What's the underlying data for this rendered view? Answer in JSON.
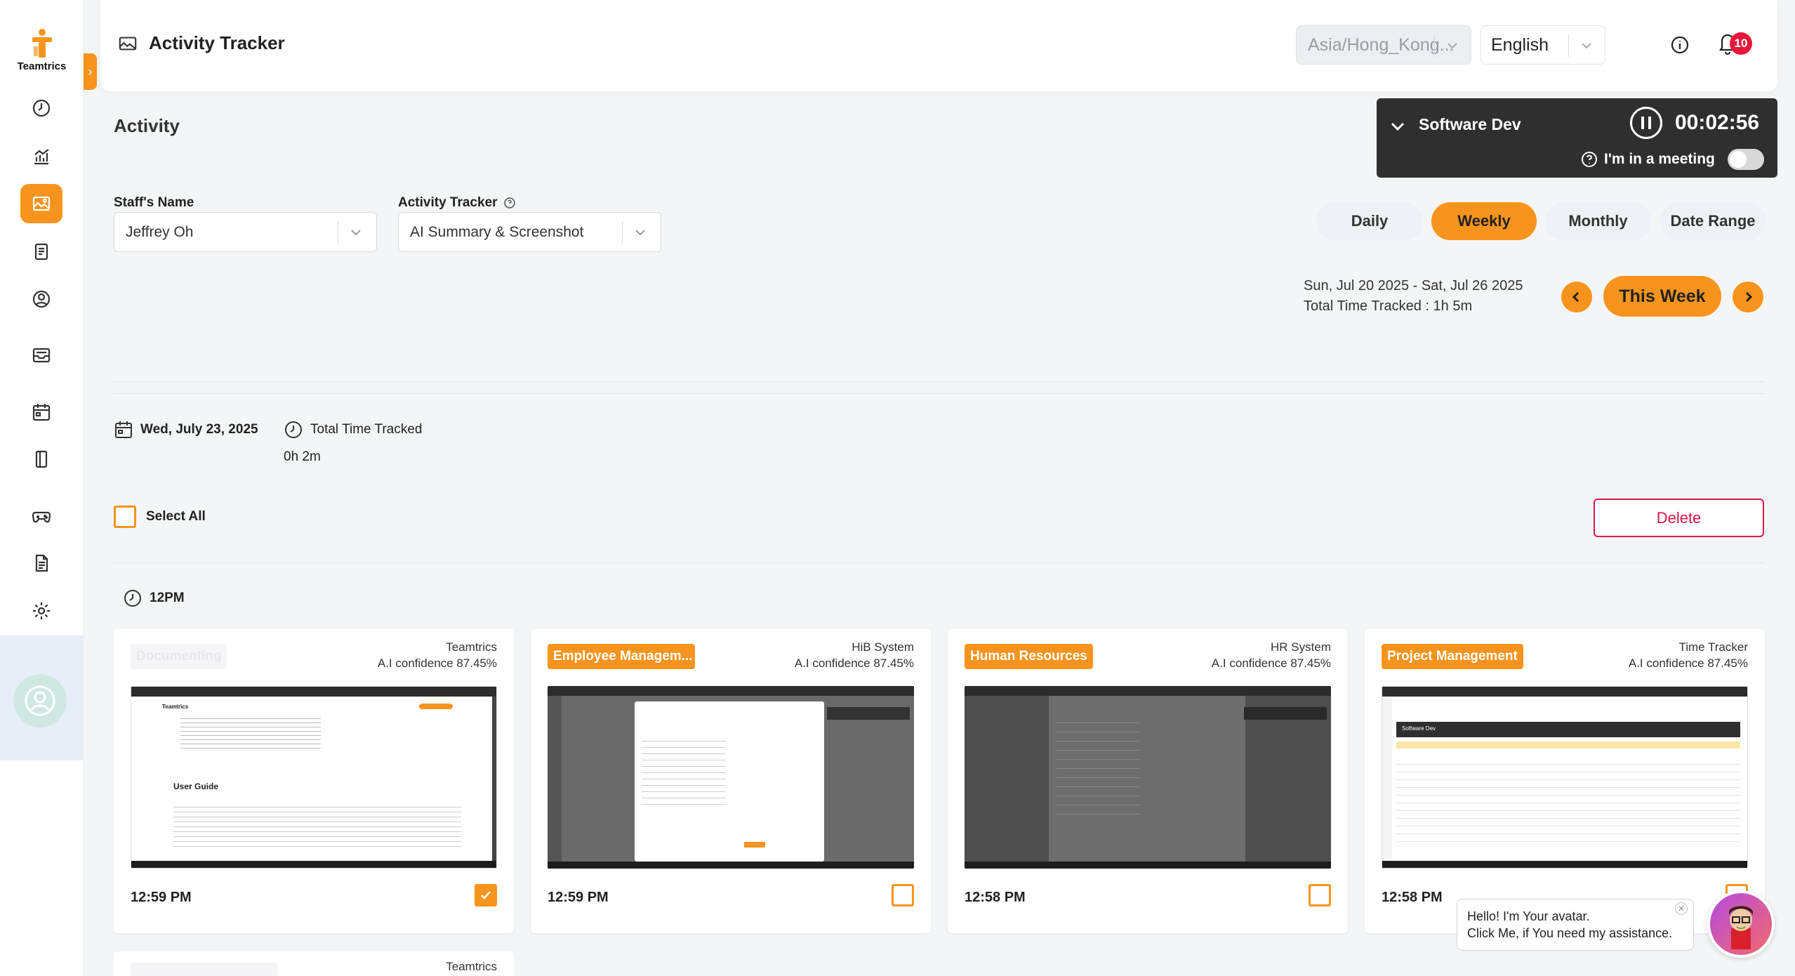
{
  "brand": {
    "name": "Teamtrics",
    "accent": "#f7941d"
  },
  "header": {
    "title": "Activity Tracker",
    "timezone": "Asia/Hong_Kong...",
    "language": "English",
    "notification_count": "10"
  },
  "timer": {
    "project": "Software Dev",
    "elapsed": "00:02:56",
    "meeting_label": "I'm in a meeting"
  },
  "page": {
    "title": "Activity"
  },
  "filters": {
    "staff_label": "Staff's Name",
    "staff_value": "Jeffrey Oh",
    "tracker_label": "Activity Tracker",
    "tracker_value": "AI Summary & Screenshot"
  },
  "periods": {
    "daily": "Daily",
    "weekly": "Weekly",
    "monthly": "Monthly",
    "date_range": "Date Range",
    "selected": "Weekly"
  },
  "range": {
    "dates": "Sun, Jul 20 2025 - Sat, Jul 26 2025",
    "total": "Total Time Tracked : 1h 5m",
    "this_week": "This Week"
  },
  "day": {
    "date": "Wed, July 23, 2025",
    "total_label": "Total Time Tracked",
    "total_value": "0h 2m"
  },
  "actions": {
    "select_all": "Select All",
    "delete": "Delete"
  },
  "hour": "12PM",
  "cards": [
    {
      "tag": "Documenting",
      "app": "Teamtrics",
      "confidence": "A.I confidence 87.45%",
      "time": "12:59 PM",
      "checked": true
    },
    {
      "tag": "Employee Managem...",
      "app": "HiB System",
      "confidence": "A.I confidence 87.45%",
      "time": "12:59 PM",
      "checked": false
    },
    {
      "tag": "Human Resources",
      "app": "HR System",
      "confidence": "A.I confidence 87.45%",
      "time": "12:58 PM",
      "checked": false
    },
    {
      "tag": "Project Management",
      "app": "Time Tracker",
      "confidence": "A.I confidence 87.45%",
      "time": "12:58 PM",
      "checked": false
    }
  ],
  "next_card": {
    "app": "Teamtrics"
  },
  "shot1": {
    "title": "User Guide",
    "brand": "Teamtrics"
  },
  "shot4": {
    "project": "Software Dev"
  },
  "chat": {
    "line1": "Hello! I'm Your avatar.",
    "line2": "Click Me, if You need my assistance."
  },
  "sidebar_icons": [
    "clock-icon",
    "chart-icon",
    "image-icon",
    "clipboard-icon",
    "user-circle-icon",
    "inbox-icon",
    "calendar-icon",
    "tablet-icon",
    "gamepad-icon",
    "document-icon",
    "gear-icon"
  ]
}
